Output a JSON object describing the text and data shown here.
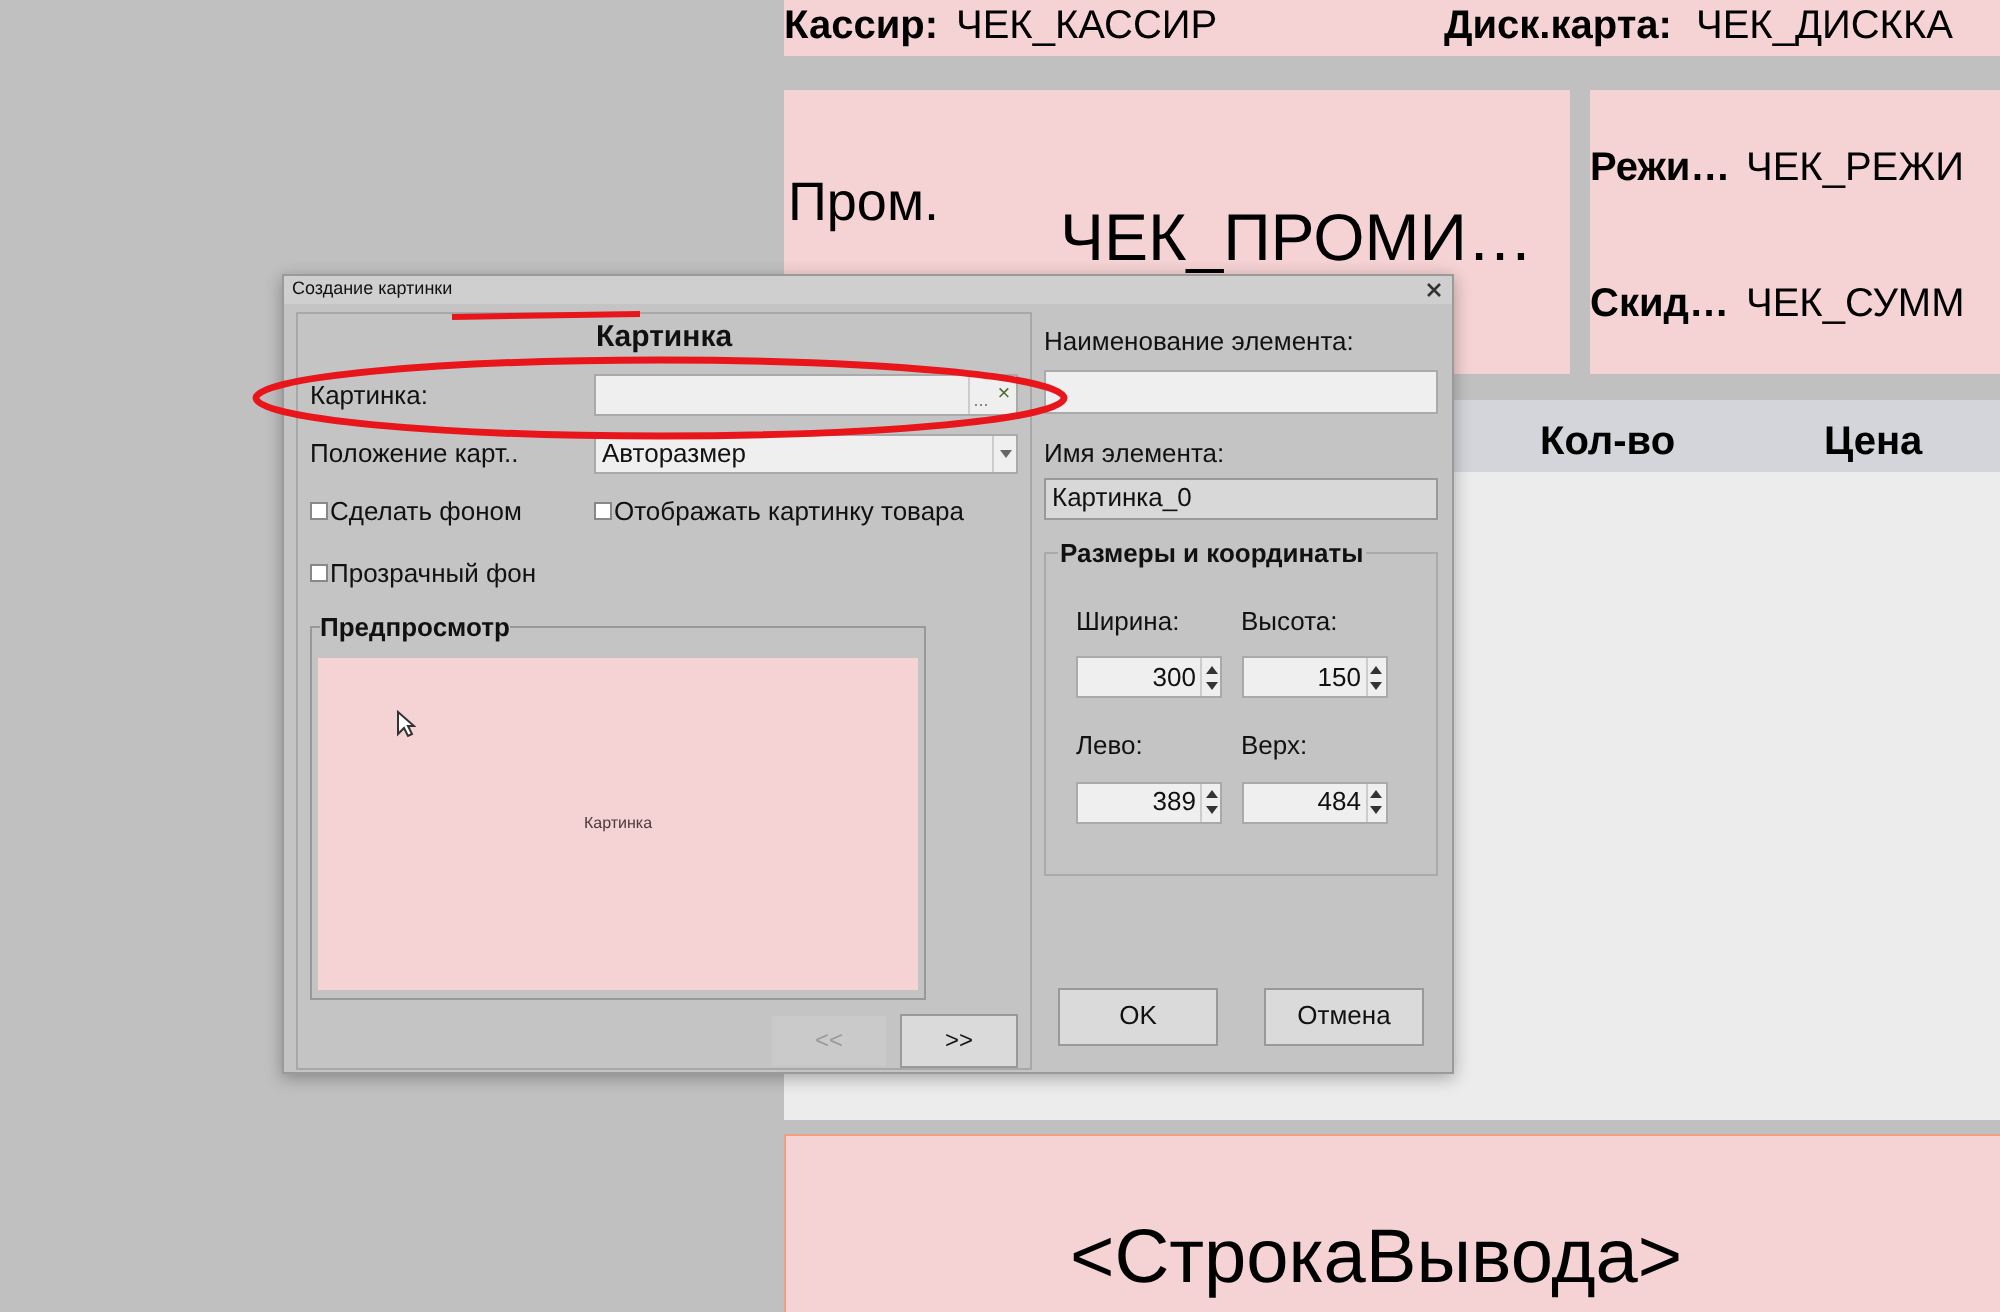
{
  "canvas": {
    "top_row": [
      {
        "label": "Кассир:",
        "value": "ЧЕК_КАССИР"
      },
      {
        "label": "Диск.карта:",
        "value": "ЧЕК_ДИСККА"
      }
    ],
    "subtotal": {
      "label": "Пром.",
      "value": "ЧЕК_ПРОМИ…"
    },
    "side_fields": [
      {
        "label": "Режи…",
        "value": "ЧЕК_РЕЖИ"
      },
      {
        "label": "Скид…",
        "value": "ЧЕК_СУММ"
      }
    ],
    "table_columns": [
      "Кол-во",
      "Цена"
    ],
    "output_line": "<СтрокаВывода>"
  },
  "dialog": {
    "title": "Создание картинки",
    "heading": "Картинка",
    "picture_field": {
      "label": "Картинка:",
      "browse": "...",
      "clear": "×"
    },
    "position_field": {
      "label": "Положение карт..",
      "value": "Авторазмер"
    },
    "checkboxes": [
      {
        "label": "Сделать фоном",
        "checked": false
      },
      {
        "label": "Отображать картинку товара",
        "checked": false
      },
      {
        "label": "Прозрачный фон",
        "checked": false
      }
    ],
    "preview": {
      "title": "Предпросмотр",
      "text": "Картинка"
    },
    "nav_buttons": [
      {
        "label": "<<",
        "disabled": true
      },
      {
        "label": ">>",
        "disabled": false
      }
    ],
    "element_name": {
      "label": "Наименование элемента:"
    },
    "element_id": {
      "label": "Имя элемента:",
      "value": "Картинка_0"
    },
    "size_group": {
      "title": "Размеры и координаты",
      "fields": [
        {
          "label": "Ширина:",
          "value": "300"
        },
        {
          "label": "Высота:",
          "value": "150"
        },
        {
          "label": "Лево:",
          "value": "389"
        },
        {
          "label": "Верх:",
          "value": "484"
        }
      ]
    },
    "buttons": [
      "OK",
      "Отмена"
    ]
  }
}
